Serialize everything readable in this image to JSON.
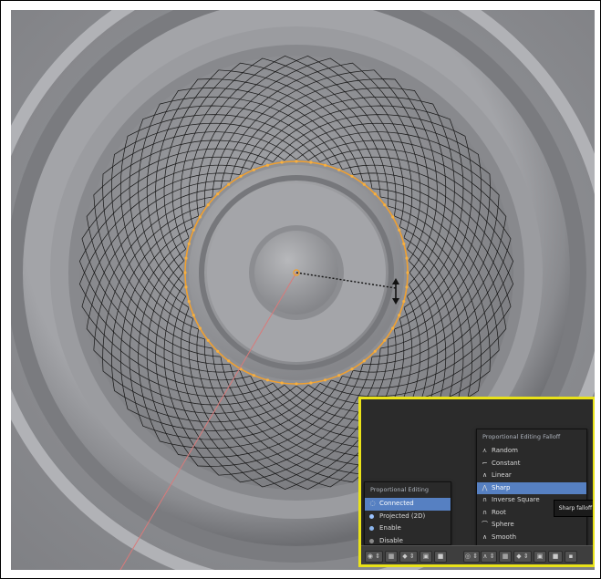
{
  "colors": {
    "callout_border": "#e9e218",
    "selection_orange": "#f0a030",
    "menu_highlight": "#5680c2",
    "viewport_gray": "#8e8f93"
  },
  "viewport": {
    "pivot_icon": "pivot-dot-icon",
    "scale_cursor_icon": "double-arrow-cursor-icon"
  },
  "proportional_editing_menu": {
    "title": "Proportional Editing",
    "items": [
      {
        "label": "Connected",
        "icon": "connected-icon",
        "active": true
      },
      {
        "label": "Projected (2D)",
        "icon": "projected-icon",
        "active": false
      },
      {
        "label": "Enable",
        "icon": "enable-icon",
        "active": false
      },
      {
        "label": "Disable",
        "icon": "disable-icon",
        "active": false
      }
    ]
  },
  "falloff_menu": {
    "title": "Proportional Editing Falloff",
    "items": [
      {
        "label": "Random",
        "icon": "random-falloff-icon",
        "active": false
      },
      {
        "label": "Constant",
        "icon": "constant-falloff-icon",
        "active": false
      },
      {
        "label": "Linear",
        "icon": "linear-falloff-icon",
        "active": false
      },
      {
        "label": "Sharp",
        "icon": "sharp-falloff-icon",
        "active": true
      },
      {
        "label": "Inverse Square",
        "icon": "inverse-square-falloff-icon",
        "active": false
      },
      {
        "label": "Root",
        "icon": "root-falloff-icon",
        "active": false
      },
      {
        "label": "Sphere",
        "icon": "sphere-falloff-icon",
        "active": false
      },
      {
        "label": "Smooth",
        "icon": "smooth-falloff-icon",
        "active": false
      }
    ]
  },
  "tooltip": {
    "text": "Sharp falloff"
  }
}
